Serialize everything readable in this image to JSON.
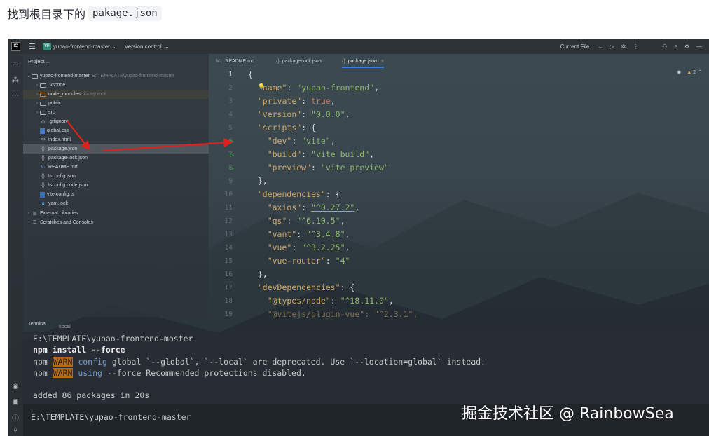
{
  "heading": {
    "text": "找到根目录下的",
    "code": "pakage.json"
  },
  "titlebar": {
    "logo": "IC",
    "project_badge": "YF",
    "project_name": "yupao-frontend-master",
    "version_control": "Version control",
    "run_config": "Current File"
  },
  "project_panel": {
    "title": "Project",
    "root": {
      "name": "yupao-frontend-master",
      "path": "E:\\TEMPLATE\\yupao-frontend-master"
    },
    "items": [
      {
        "name": ".vscode",
        "kind": "folder"
      },
      {
        "name": "node_modules",
        "kind": "folder-excluded",
        "note": "library root"
      },
      {
        "name": "public",
        "kind": "folder"
      },
      {
        "name": "src",
        "kind": "folder"
      },
      {
        "name": ".gitignore",
        "kind": "ignore"
      },
      {
        "name": "global.css",
        "kind": "css"
      },
      {
        "name": "index.html",
        "kind": "html"
      },
      {
        "name": "package.json",
        "kind": "json",
        "selected": true
      },
      {
        "name": "package-lock.json",
        "kind": "json"
      },
      {
        "name": "README.md",
        "kind": "md"
      },
      {
        "name": "tsconfig.json",
        "kind": "json"
      },
      {
        "name": "tsconfig.node.json",
        "kind": "json"
      },
      {
        "name": "vite.config.ts",
        "kind": "ts"
      },
      {
        "name": "yarn.lock",
        "kind": "yarn"
      }
    ],
    "external_libraries": "External Libraries",
    "scratches": "Scratches and Consoles"
  },
  "tabs": [
    {
      "label": "README.md"
    },
    {
      "label": "package-lock.json"
    },
    {
      "label": "package.json",
      "active": true
    }
  ],
  "editor": {
    "warning_count": "2",
    "line_numbers": [
      "1",
      "2",
      "3",
      "4",
      "5",
      "6",
      "7",
      "8",
      "9",
      "10",
      "11",
      "12",
      "13",
      "14",
      "15",
      "16",
      "17",
      "18",
      "19"
    ],
    "json_key_name": "\"name\"",
    "json_val_name": "\"yupao-frontend\"",
    "json_key_private": "\"private\"",
    "json_val_private": "true",
    "json_key_version": "\"version\"",
    "json_val_version": "\"0.0.0\"",
    "json_key_scripts": "\"scripts\"",
    "json_key_dev": "\"dev\"",
    "json_val_dev": "\"vite\"",
    "json_key_build": "\"build\"",
    "json_val_build": "\"vite build\"",
    "json_key_preview": "\"preview\"",
    "json_val_preview": "\"vite preview\"",
    "json_key_deps": "\"dependencies\"",
    "json_key_axios": "\"axios\"",
    "json_val_axios": "\"^0.27.2\"",
    "json_key_qs": "\"qs\"",
    "json_val_qs": "\"^6.10.5\"",
    "json_key_vant": "\"vant\"",
    "json_val_vant": "\"^3.4.8\"",
    "json_key_vue": "\"vue\"",
    "json_val_vue": "\"^3.2.25\"",
    "json_key_router": "\"vue-router\"",
    "json_val_router": "\"4\"",
    "json_key_devdeps": "\"devDependencies\"",
    "json_key_types": "\"@types/node\"",
    "json_val_types": "\"^18.11.0\"",
    "json_partial": "\"@vitejs/plugin-vue\": \"^2.3.1\","
  },
  "terminal": {
    "tab_terminal": "Terminal",
    "tab_local": "Local",
    "lines": {
      "prompt1": "E:\\TEMPLATE\\yupao-frontend-master",
      "cmd": "npm install --force",
      "npm1": "npm",
      "warn1": "WARN",
      "cfg": "config",
      "msg1": "global `--global`, `--local` are deprecated. Use `--location=global` instead.",
      "npm2": "npm",
      "warn2": "WARN",
      "using": "using",
      "msg2": "--force Recommended protections disabled.",
      "added": "added 86 packages in 20s",
      "prompt2": "E:\\TEMPLATE\\yupao-frontend-master"
    }
  },
  "watermark": "掘金技术社区 @ RainbowSea",
  "colors": {
    "arrow": "#e0201c",
    "accent": "#3d7ee6",
    "run": "#4fb84f",
    "warn_bg": "#b86a14"
  }
}
